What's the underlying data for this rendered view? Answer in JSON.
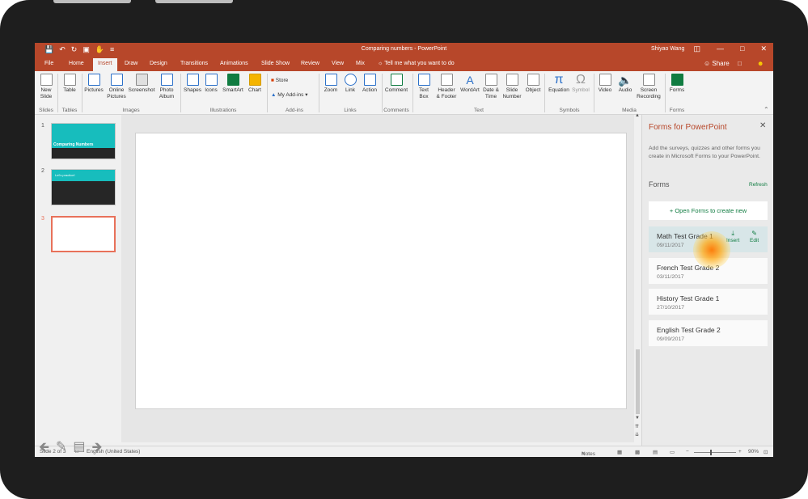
{
  "titlebar": {
    "document_title": "Comparing numbers - PowerPoint",
    "user_name": "Shiyao Wang",
    "qat_icons": [
      "save-icon",
      "undo-icon",
      "redo-icon",
      "start-from-beginning-icon",
      "touch-mode-icon",
      "customize-icon"
    ],
    "window_controls": [
      "restore-ribbon-icon",
      "minimize-icon",
      "maximize-icon",
      "close-icon"
    ]
  },
  "tabs": {
    "items": [
      "File",
      "Home",
      "Insert",
      "Draw",
      "Design",
      "Transitions",
      "Animations",
      "Slide Show",
      "Review",
      "View",
      "Mix"
    ],
    "active": "Insert",
    "tell_me": "Tell me what you want to do",
    "share": "Share"
  },
  "ribbon": {
    "new_slide": [
      "New",
      "Slide"
    ],
    "table": "Table",
    "pictures": "Pictures",
    "online_pictures": [
      "Online",
      "Pictures"
    ],
    "screenshot": "Screenshot",
    "photo_album": [
      "Photo",
      "Album"
    ],
    "shapes": "Shapes",
    "icons": "Icons",
    "smartart": "SmartArt",
    "chart": "Chart",
    "store": "Store",
    "my_addins": "My Add-ins",
    "zoom": "Zoom",
    "link": "Link",
    "action": "Action",
    "comment": "Comment",
    "text_box": [
      "Text",
      "Box"
    ],
    "header_footer": [
      "Header",
      "& Footer"
    ],
    "wordart": "WordArt",
    "date_time": [
      "Date &",
      "Time"
    ],
    "slide_number": [
      "Slide",
      "Number"
    ],
    "object": "Object",
    "equation": "Equation",
    "symbol": "Symbol",
    "video": "Video",
    "audio": "Audio",
    "screen_recording": [
      "Screen",
      "Recording"
    ],
    "forms": "Forms",
    "groups": {
      "slides": "Slides",
      "tables": "Tables",
      "images": "Images",
      "illustrations": "Illustrations",
      "addins": "Add-ins",
      "links": "Links",
      "comments": "Comments",
      "text": "Text",
      "symbols": "Symbols",
      "media": "Media",
      "forms": "Forms"
    }
  },
  "thumbnails": [
    {
      "number": "1",
      "title": "Comparing Numbers"
    },
    {
      "number": "2",
      "title": "Let's practice!"
    },
    {
      "number": "3",
      "title": ""
    }
  ],
  "statusbar": {
    "slide_info": "Slide 2 of 3",
    "language": "English (United States)",
    "notes": "Notes",
    "zoom": "90%"
  },
  "forms_pane": {
    "title": "Forms for PowerPoint",
    "description": "Add the surveys, quizzes and other forms you create in Microsoft Forms to your PowerPoint.",
    "forms_label": "Forms",
    "refresh": "Refresh",
    "open_forms": "+ Open Forms to create new",
    "insert_label": "Insert",
    "edit_label": "Edit",
    "items": [
      {
        "name": "Math Test Grade 1",
        "date": "09/11/2017"
      },
      {
        "name": "French Test Grade 2",
        "date": "03/11/2017"
      },
      {
        "name": "History Test Grade 1",
        "date": "27/10/2017"
      },
      {
        "name": "English Test Grade 2",
        "date": "09/09/2017"
      }
    ]
  },
  "colors": {
    "accent": "#b7472a",
    "forms_green": "#107c41",
    "selected_thumb": "#e8715a",
    "teal": "#17bdbd"
  }
}
